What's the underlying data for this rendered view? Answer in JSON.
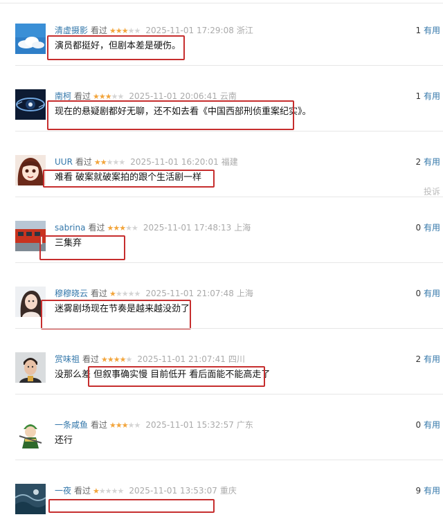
{
  "reviews": [
    {
      "user": "清虚摄影",
      "seen": "看过",
      "rating": 3,
      "date": "2025-11-01 17:29:08",
      "location": "浙江",
      "useful_count": "1",
      "useful_label": "有用",
      "comment": "演员都挺好，但剧本差是硬伤。",
      "avatar_icon": "sky-cloud-avatar"
    },
    {
      "user": "南柯",
      "seen": "看过",
      "rating": 3,
      "date": "2025-11-01 20:06:41",
      "location": "云南",
      "useful_count": "1",
      "useful_label": "有用",
      "comment": "现在的悬疑剧都好无聊，还不如去看《中国西部刑侦重案纪实》。",
      "avatar_icon": "dark-eye-avatar"
    },
    {
      "user": "UUR",
      "seen": "看过",
      "rating": 2,
      "date": "2025-11-01 16:20:01",
      "location": "福建",
      "useful_count": "2",
      "useful_label": "有用",
      "comment": "难看 破案就破案拍的跟个生活剧一样",
      "avatar_icon": "anime-girl-avatar",
      "report_label": "投诉"
    },
    {
      "user": "sabrina",
      "seen": "看过",
      "rating": 3,
      "date": "2025-11-01 17:48:13",
      "location": "上海",
      "useful_count": "0",
      "useful_label": "有用",
      "comment": "三集弃",
      "avatar_icon": "red-train-avatar"
    },
    {
      "user": "穆穆晓云",
      "seen": "看过",
      "rating": 1,
      "date": "2025-11-01 21:07:48",
      "location": "上海",
      "useful_count": "0",
      "useful_label": "有用",
      "comment": "迷雾剧场现在节奏是越来越没劲了",
      "avatar_icon": "woman-portrait-avatar"
    },
    {
      "user": "赏味祖",
      "seen": "看过",
      "rating": 4,
      "date": "2025-11-01 21:07:41",
      "location": "四川",
      "useful_count": "2",
      "useful_label": "有用",
      "comment": "没那么差 但叙事确实慢 目前低开 看后面能不能高走了",
      "avatar_icon": "man-portrait-avatar"
    },
    {
      "user": "一条咸鱼",
      "seen": "看过",
      "rating": 3,
      "date": "2025-11-01 15:32:57",
      "location": "广东",
      "useful_count": "0",
      "useful_label": "有用",
      "comment": "还行",
      "avatar_icon": "green-character-avatar"
    },
    {
      "user": "一夜",
      "seen": "看过",
      "rating": 1,
      "date": "2025-11-01 13:53:07",
      "location": "重庆",
      "useful_count": "9",
      "useful_label": "有用",
      "comment": "",
      "avatar_icon": "storm-sea-avatar"
    }
  ],
  "colors": {
    "username": "#3377aa",
    "star_on": "#f2a53c",
    "star_off": "#d4d4d4",
    "highlight": "#c62d2d"
  }
}
